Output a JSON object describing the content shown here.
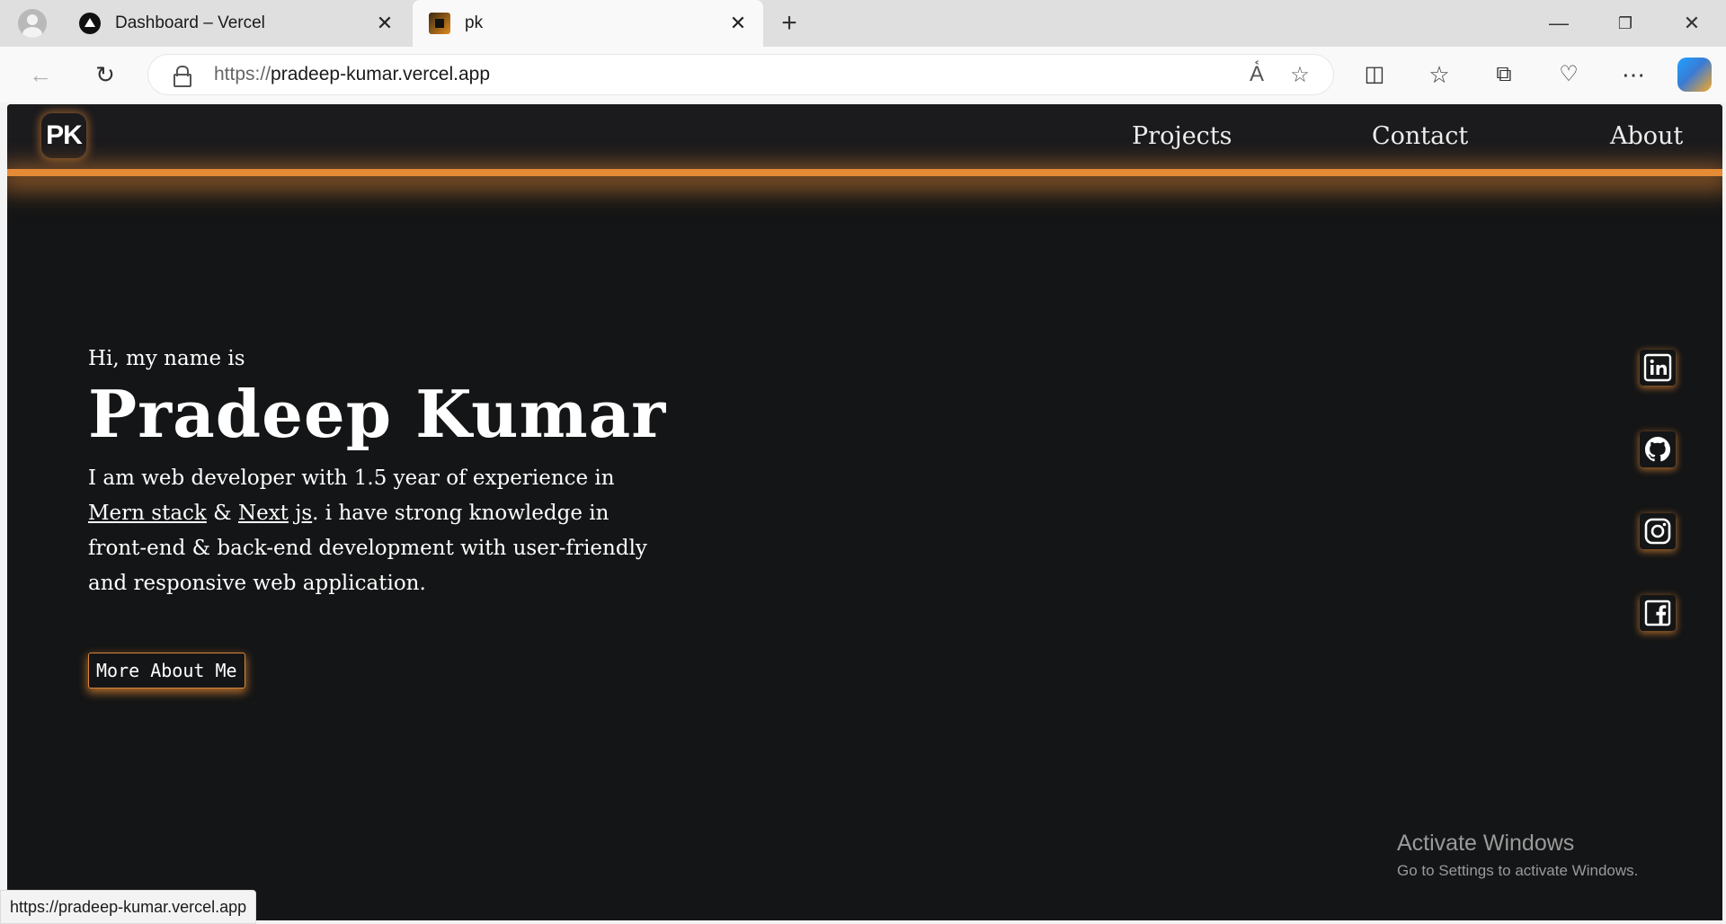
{
  "browser": {
    "tabs": [
      {
        "title": "Dashboard – Vercel",
        "active": false,
        "icon": "vercel-icon"
      },
      {
        "title": "pk",
        "active": true,
        "icon": "pk-favicon"
      }
    ],
    "url_scheme": "https://",
    "url_host": "pradeep-kumar.vercel.app",
    "status_url": "https://pradeep-kumar.vercel.app",
    "window_controls": {
      "minimize": "—",
      "restore": "❐",
      "close": "✕"
    }
  },
  "site": {
    "logo": "PK",
    "nav": [
      "Projects",
      "Contact",
      "About"
    ],
    "greeting": "Hi, my name is",
    "name": "Pradeep Kumar",
    "bio": {
      "line1": "I am web developer with 1.5 year of experience in",
      "mern": "Mern stack",
      "amp": "&",
      "next": "Next",
      "js": "js",
      "line2_rest": ". i have strong knowledge in front-end & back-end development with user-friendly and responsive web application."
    },
    "more_button": "More About Me",
    "socials": [
      "linkedin-icon",
      "github-icon",
      "instagram-icon",
      "facebook-icon"
    ],
    "accent_color": "#e58a35",
    "background_color": "#141516"
  },
  "windows_watermark": {
    "title": "Activate Windows",
    "subtitle": "Go to Settings to activate Windows."
  }
}
